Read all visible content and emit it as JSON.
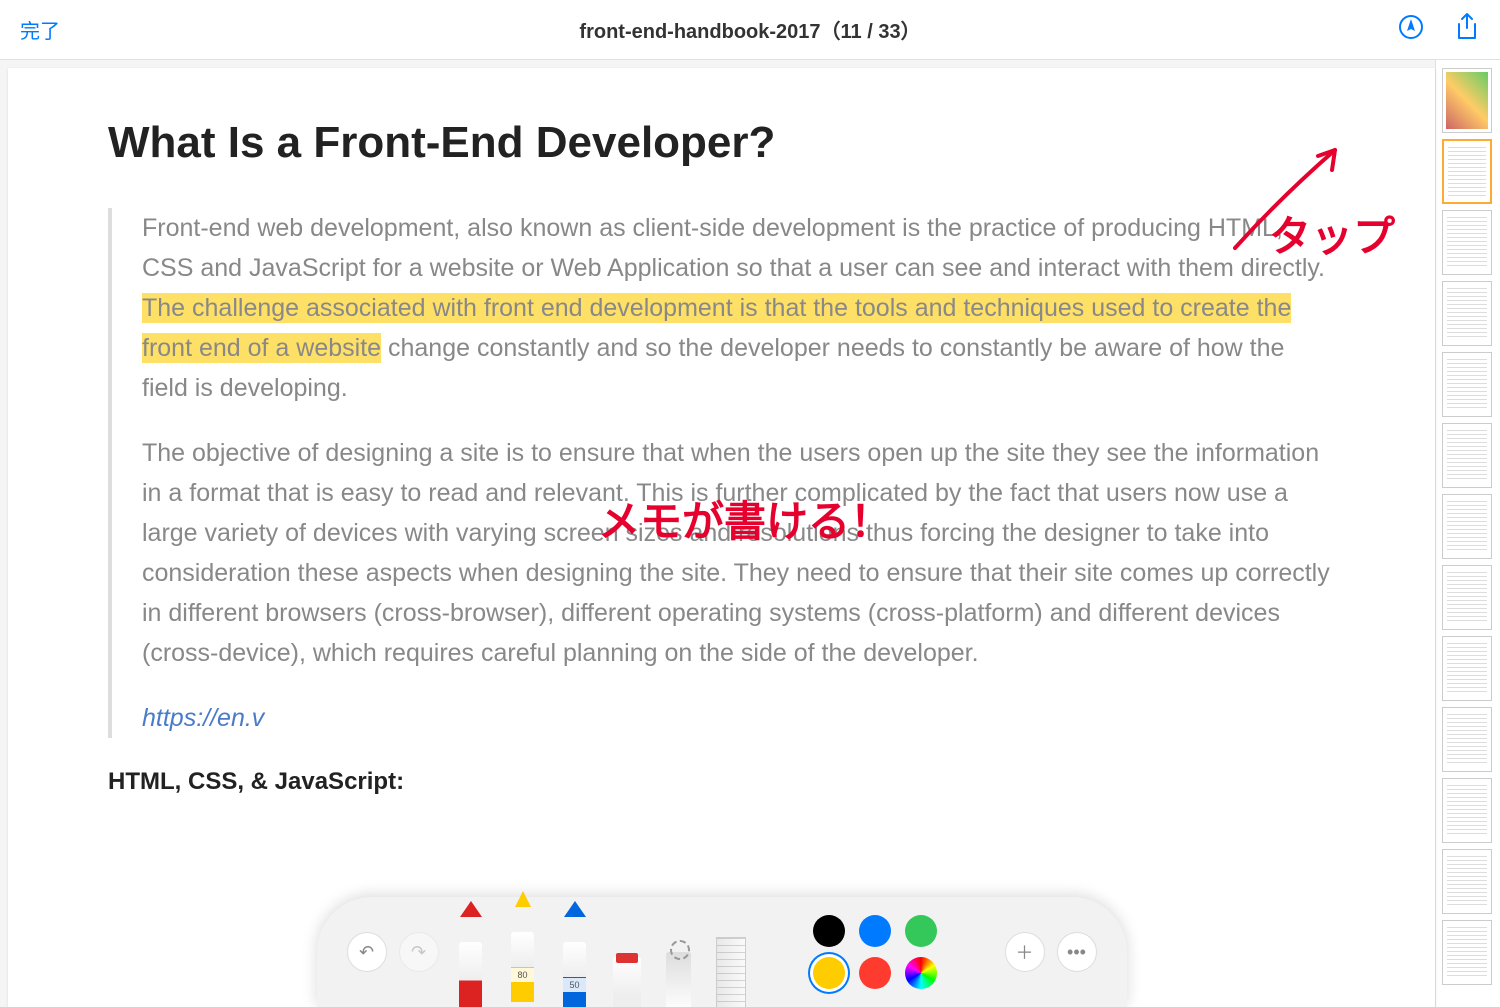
{
  "header": {
    "done": "完了",
    "title": "front-end-handbook-2017（11 / 33）"
  },
  "document": {
    "heading": "What Is a Front-End Developer?",
    "para1_before": "Front-end web development, also known as client-side development is the practice of producing HTML, CSS and JavaScript for a website or Web Application so that a user can see and interact with them directly. ",
    "para1_highlight": "The challenge associated with front end development is that the tools and techniques used to create the front end of a website",
    "para1_after": " change constantly and so the developer needs to constantly be aware of how the field is developing.",
    "para2": "The objective of designing a site is to ensure that when the users open up the site they see the information in a format that is easy to read and relevant. This is further complicated by the fact that users now use a large variety of devices with varying screen sizes and resolutions thus forcing the designer to take into consideration these aspects when designing the site. They need to ensure that their site comes up correctly in different browsers (cross-browser), different operating systems (cross-platform) and different devices (cross-device), which requires careful planning on the side of the developer.",
    "link_cut": "https://en.v",
    "h2_cut": "HTML, CSS, & JavaScript:"
  },
  "annotations": {
    "tap": "タップ",
    "memo": "メモが書ける！"
  },
  "markup": {
    "highlighter_size": "80",
    "pencil_size": "50"
  },
  "colors": {
    "black": "#000000",
    "blue": "#007aff",
    "green": "#34c759",
    "yellow": "#ffcc00",
    "red": "#ff3b30"
  }
}
